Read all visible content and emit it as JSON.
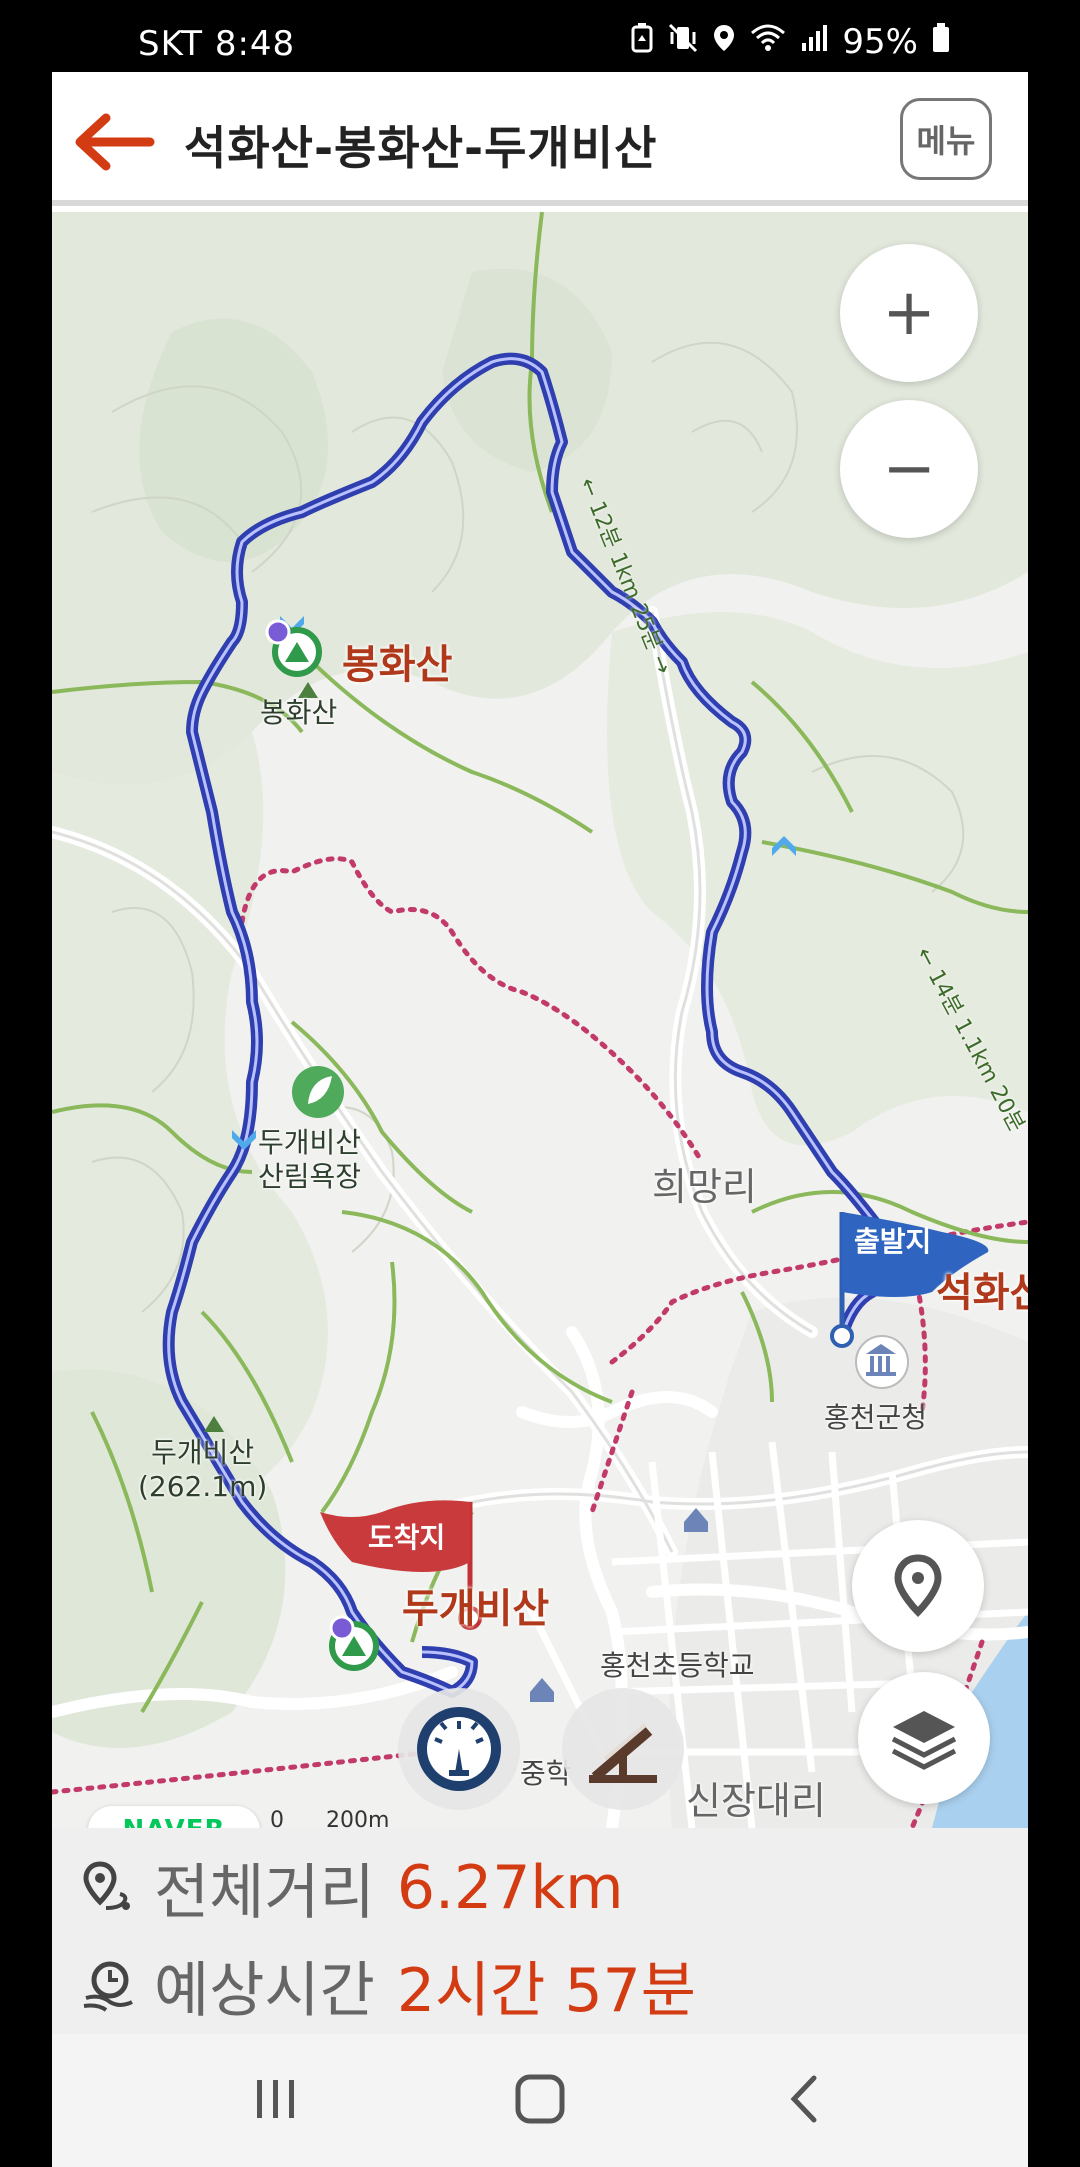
{
  "status_bar": {
    "carrier_time": "SKT  8:48",
    "battery": "95%",
    "icons": [
      "battery-saver-icon",
      "vibrate-icon",
      "location-icon",
      "wifi-icon",
      "signal-icon",
      "battery-icon"
    ]
  },
  "header": {
    "title": "석화산-봉화산-두개비산",
    "back_icon": "arrow-left-icon",
    "menu_label": "메뉴",
    "accent_color": "#d33b13"
  },
  "map": {
    "zoom_in_label": "+",
    "zoom_out_label": "−",
    "route_color": "#2f3fb0",
    "labels": {
      "bonghwasan_big": "봉화산",
      "bonghwasan_small": "봉화산",
      "forest_bath": "두개비산\n산림욕장",
      "village": "희망리",
      "start_flag": "출발지",
      "seokhwasan": "석화산",
      "county_office": "홍천군청",
      "dugaebisan_peak": "두개비산\n(262.1m)",
      "finish_flag": "도착지",
      "dugaebisan_big": "두개비산",
      "school": "홍천초등학교",
      "sinjangdaeri": "신장대리",
      "partial_school": "중학",
      "trail_1": "← 12분 1km 25분 →",
      "trail_2": "← 14분 1.1km 20분"
    },
    "naver_logo": "NAVER",
    "scale_label": "0      200m",
    "buttons": [
      "my-location-icon",
      "layers-icon",
      "compass-gauge-icon",
      "elevation-profile-icon"
    ]
  },
  "summary": {
    "distance_label": "전체거리",
    "distance_value": "6.27km",
    "time_label": "예상시간",
    "time_value": "2시간 57분"
  },
  "navbar": {
    "buttons": [
      "recent-apps-icon",
      "home-icon",
      "back-icon"
    ]
  }
}
